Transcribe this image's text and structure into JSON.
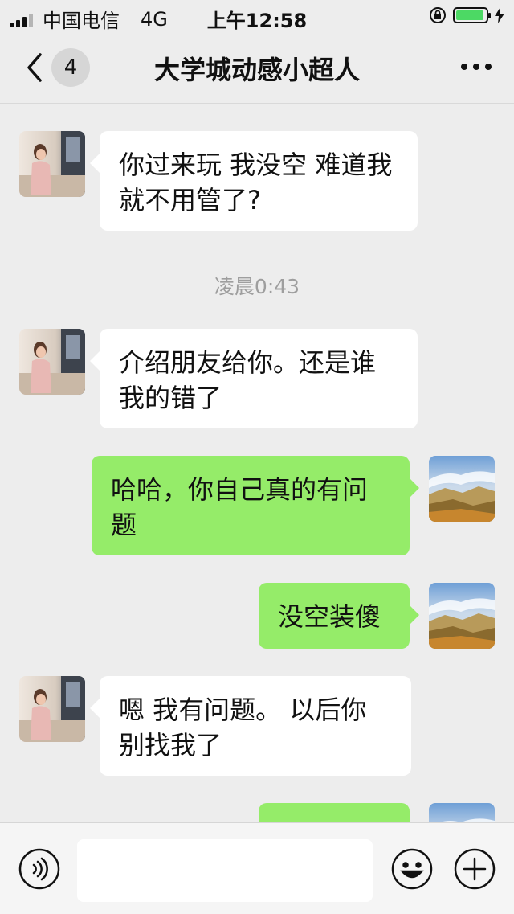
{
  "status_bar": {
    "carrier": "中国电信",
    "network": "4G",
    "time": "上午12:58",
    "signal_icon": "signal-bars-icon",
    "lock_icon": "orientation-lock-icon",
    "battery_level": 0.95,
    "charging_icon": "charging-bolt-icon"
  },
  "nav": {
    "back_icon": "chevron-left-icon",
    "unread_count": "4",
    "title": "大学城动感小超人",
    "more_icon": "more-dots-icon"
  },
  "messages": [
    {
      "side": "in",
      "text": "你过来玩  我没空  难道我就不用管了?"
    },
    {
      "side": "in",
      "text": "介绍朋友给你。还是谁我的错了"
    },
    {
      "side": "out",
      "text": "哈哈，你自己真的有问题"
    },
    {
      "side": "out",
      "text": "没空装傻"
    },
    {
      "side": "in",
      "text": "嗯  我有问题。 以后你别找我了"
    },
    {
      "side": "out",
      "text": ""
    }
  ],
  "timestamps": [
    "凌晨0:43"
  ],
  "input_bar": {
    "voice_icon": "voice-icon",
    "text_value": "",
    "emoji_icon": "emoji-icon",
    "plus_icon": "plus-icon"
  },
  "colors": {
    "background": "#ededed",
    "incoming_bubble": "#ffffff",
    "outgoing_bubble": "#95ec69",
    "timestamp_text": "#9e9e9e"
  }
}
